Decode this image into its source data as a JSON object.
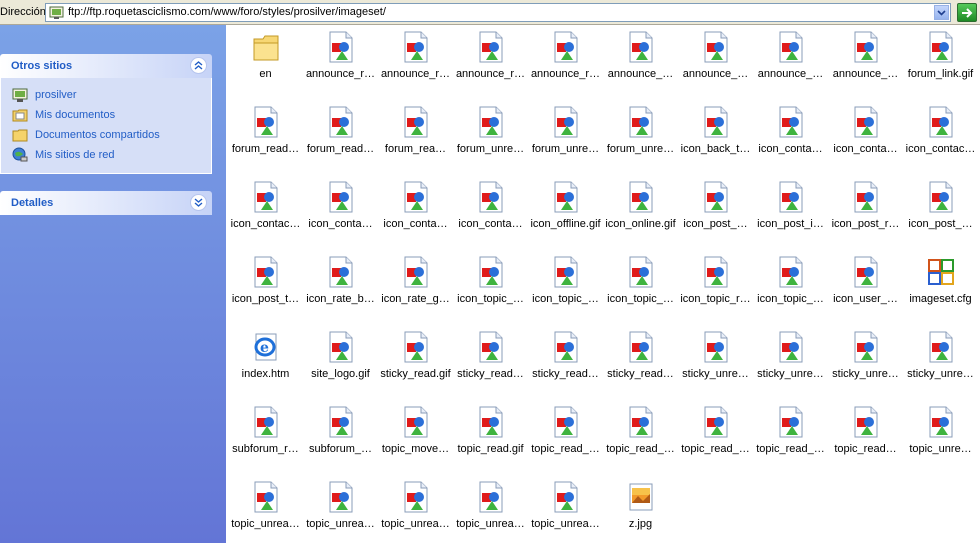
{
  "address_bar": {
    "label": "Dirección",
    "url": "ftp://ftp.roquetasciclismo.com/www/foro/styles/prosilver/imageset/"
  },
  "task_pane": {
    "other_places": {
      "title": "Otros sitios",
      "items": [
        {
          "label": "prosilver",
          "icon": "ftp-folder-icon"
        },
        {
          "label": "Mis documentos",
          "icon": "my-documents-icon"
        },
        {
          "label": "Documentos compartidos",
          "icon": "shared-folder-icon"
        },
        {
          "label": "Mis sitios de red",
          "icon": "network-places-icon"
        }
      ]
    },
    "details": {
      "title": "Detalles"
    }
  },
  "files": [
    {
      "name": "en",
      "type": "folder"
    },
    {
      "name": "announce_r…",
      "type": "gif"
    },
    {
      "name": "announce_r…",
      "type": "gif"
    },
    {
      "name": "announce_r…",
      "type": "gif"
    },
    {
      "name": "announce_r…",
      "type": "gif"
    },
    {
      "name": "announce_…",
      "type": "gif"
    },
    {
      "name": "announce_…",
      "type": "gif"
    },
    {
      "name": "announce_…",
      "type": "gif"
    },
    {
      "name": "announce_…",
      "type": "gif"
    },
    {
      "name": "forum_link.gif",
      "type": "gif"
    },
    {
      "name": "forum_read…",
      "type": "gif"
    },
    {
      "name": "forum_read…",
      "type": "gif"
    },
    {
      "name": "forum_rea…",
      "type": "gif"
    },
    {
      "name": "forum_unre…",
      "type": "gif"
    },
    {
      "name": "forum_unre…",
      "type": "gif"
    },
    {
      "name": "forum_unre…",
      "type": "gif"
    },
    {
      "name": "icon_back_t…",
      "type": "gif"
    },
    {
      "name": "icon_conta…",
      "type": "gif"
    },
    {
      "name": "icon_conta…",
      "type": "gif"
    },
    {
      "name": "icon_contac…",
      "type": "gif"
    },
    {
      "name": "icon_contac…",
      "type": "gif"
    },
    {
      "name": "icon_conta…",
      "type": "gif"
    },
    {
      "name": "icon_conta…",
      "type": "gif"
    },
    {
      "name": "icon_conta…",
      "type": "gif"
    },
    {
      "name": "icon_offline.gif",
      "type": "gif"
    },
    {
      "name": "icon_online.gif",
      "type": "gif"
    },
    {
      "name": "icon_post_…",
      "type": "gif"
    },
    {
      "name": "icon_post_i…",
      "type": "gif"
    },
    {
      "name": "icon_post_r…",
      "type": "gif"
    },
    {
      "name": "icon_post_…",
      "type": "gif"
    },
    {
      "name": "icon_post_t…",
      "type": "gif"
    },
    {
      "name": "icon_rate_b…",
      "type": "gif"
    },
    {
      "name": "icon_rate_g…",
      "type": "gif"
    },
    {
      "name": "icon_topic_…",
      "type": "gif"
    },
    {
      "name": "icon_topic_…",
      "type": "gif"
    },
    {
      "name": "icon_topic_…",
      "type": "gif"
    },
    {
      "name": "icon_topic_r…",
      "type": "gif"
    },
    {
      "name": "icon_topic_…",
      "type": "gif"
    },
    {
      "name": "icon_user_…",
      "type": "gif"
    },
    {
      "name": "imageset.cfg",
      "type": "cfg"
    },
    {
      "name": "index.htm",
      "type": "htm"
    },
    {
      "name": "site_logo.gif",
      "type": "gif"
    },
    {
      "name": "sticky_read.gif",
      "type": "gif"
    },
    {
      "name": "sticky_read…",
      "type": "gif"
    },
    {
      "name": "sticky_read…",
      "type": "gif"
    },
    {
      "name": "sticky_read…",
      "type": "gif"
    },
    {
      "name": "sticky_unre…",
      "type": "gif"
    },
    {
      "name": "sticky_unre…",
      "type": "gif"
    },
    {
      "name": "sticky_unre…",
      "type": "gif"
    },
    {
      "name": "sticky_unre…",
      "type": "gif"
    },
    {
      "name": "subforum_r…",
      "type": "gif"
    },
    {
      "name": "subforum_…",
      "type": "gif"
    },
    {
      "name": "topic_move…",
      "type": "gif"
    },
    {
      "name": "topic_read.gif",
      "type": "gif"
    },
    {
      "name": "topic_read_…",
      "type": "gif"
    },
    {
      "name": "topic_read_…",
      "type": "gif"
    },
    {
      "name": "topic_read_…",
      "type": "gif"
    },
    {
      "name": "topic_read_…",
      "type": "gif"
    },
    {
      "name": "topic_read…",
      "type": "gif"
    },
    {
      "name": "topic_unre…",
      "type": "gif"
    },
    {
      "name": "topic_unrea…",
      "type": "gif"
    },
    {
      "name": "topic_unrea…",
      "type": "gif"
    },
    {
      "name": "topic_unrea…",
      "type": "gif"
    },
    {
      "name": "topic_unrea…",
      "type": "gif"
    },
    {
      "name": "topic_unrea…",
      "type": "gif"
    },
    {
      "name": "z.jpg",
      "type": "jpg"
    }
  ]
}
